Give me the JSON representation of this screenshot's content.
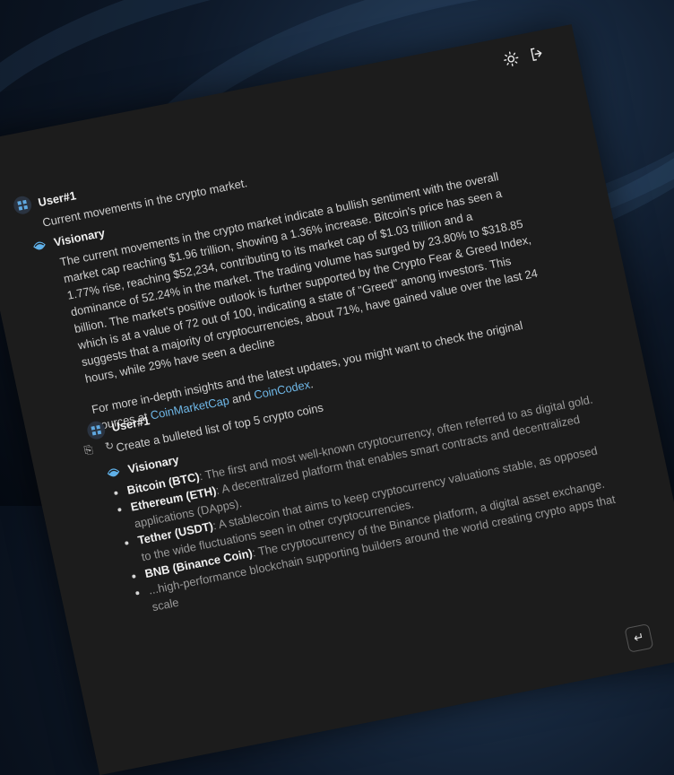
{
  "header": {
    "theme_icon": "sun-icon",
    "logout_icon": "logout-icon"
  },
  "messages": [
    {
      "author": "User#1",
      "text": "Current movements in the crypto market."
    },
    {
      "author": "Visionary",
      "para1": "The current movements in the crypto market indicate a bullish sentiment with the overall market cap reaching $1.96 trillion, showing a 1.36% increase. Bitcoin's price has seen a 1.77% rise, reaching $52,234, contributing to its market cap of $1.03 trillion and a dominance of 52.24% in the market. The trading volume has surged by 23.80% to $318.85 billion. The market's positive outlook is further supported by the Crypto Fear & Greed Index, which is at a value of 72 out of 100, indicating a state of \"Greed\" among investors. This suggests that a majority of cryptocurrencies, about 71%, have gained value over the last 24 hours, while 29% have seen a decline",
      "para2_prefix": "For more in-depth insights and the latest updates, you might want to check the original sources at",
      "link1": "CoinMarketCap",
      "para2_mid": "and",
      "link2": "CoinCodex",
      "para2_end": "."
    },
    {
      "author": "User#1",
      "text": "Create a bulleted list of top 5 crypto coins"
    },
    {
      "author": "Visionary",
      "items": [
        {
          "name": "Bitcoin (BTC)",
          "desc": ": The first and most well-known cryptocurrency, often referred to as digital gold."
        },
        {
          "name": "Ethereum (ETH)",
          "desc": ": A decentralized platform that enables smart contracts and decentralized applications (DApps)."
        },
        {
          "name": "Tether (USDT)",
          "desc": ": A stablecoin that aims to keep cryptocurrency valuations stable, as opposed to the wide fluctuations seen in other cryptocurrencies."
        },
        {
          "name": "BNB (Binance Coin)",
          "desc": ": The cryptocurrency of the Binance platform, a digital asset exchange."
        },
        {
          "name": "",
          "desc": "...high-performance blockchain supporting builders around the world creating crypto apps that scale"
        }
      ]
    }
  ],
  "actions": {
    "copy_icon": "copy-icon",
    "regenerate_icon": "regenerate-icon"
  },
  "send_icon": "enter-icon"
}
